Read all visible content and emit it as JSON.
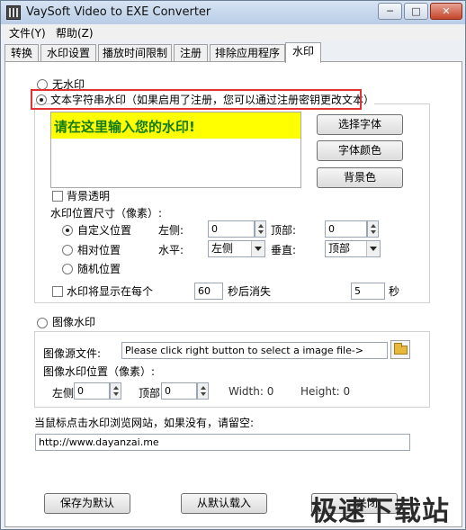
{
  "window": {
    "title": "VaySoft Video to EXE Converter",
    "min_label": "─",
    "max_label": "□",
    "close_label": "✕"
  },
  "menu": [
    "文件(Y)",
    "帮助(Z)"
  ],
  "tabs": [
    "转换",
    "水印设置",
    "播放时间限制",
    "注册",
    "排除应用程序",
    "水印"
  ],
  "text_wm": {
    "no_wm_label": "无水印",
    "text_wm_label": "文本字符串水印（如果启用了注册，您可以通过注册密钥更改文本）",
    "preview_text": "请在这里输入您的水印!",
    "select_font": "选择字体",
    "font_color": "字体颜色",
    "bg_color": "背景色",
    "transparent_bg": "背景透明",
    "pos_size_label": "水印位置尺寸（像素）:",
    "custom_pos": "自定义位置",
    "relative_pos": "相对位置",
    "random_pos": "随机位置",
    "left_label": "左侧:",
    "left_value": "0",
    "top_label": "顶部:",
    "top_value": "0",
    "horizontal_label": "水平:",
    "horizontal_value": "左侧",
    "vertical_label": "垂直:",
    "vertical_value": "顶部",
    "show_every": "水印将显示在每个",
    "show_every_value": "60",
    "disappear_after": "秒后消失",
    "disappear_value": "5",
    "seconds": "秒"
  },
  "image_wm": {
    "label": "图像水印",
    "source_label": "图像源文件:",
    "source_placeholder": "Please click right button to select a image file->",
    "pos_label": "图像水印位置（像素）:",
    "left_label": "左侧",
    "left_value": "0",
    "top_label": "顶部",
    "top_value": "0",
    "width": "Width: 0",
    "height": "Height: 0"
  },
  "url": {
    "label": "当鼠标点击水印浏览网站，如果没有，请留空:",
    "value": "http://www.dayanzai.me"
  },
  "bottom": {
    "save_default": "保存为默认",
    "load_default": "从默认载入",
    "close": "关闭"
  },
  "overlay_watermark": "极速下载站",
  "colors": {
    "preview_bg": "#ffff00",
    "preview_text": "#147a14",
    "highlight": "#e23333"
  }
}
